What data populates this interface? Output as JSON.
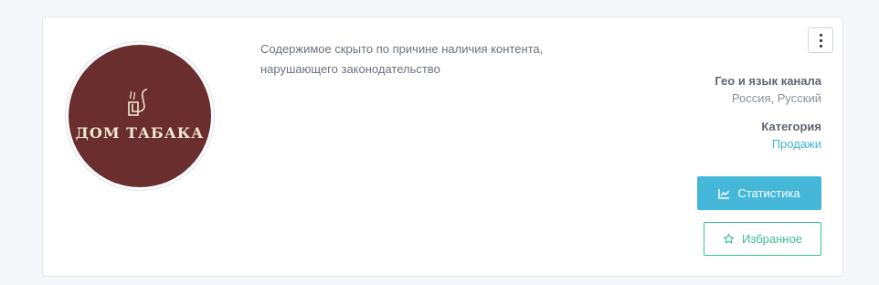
{
  "channel": {
    "avatar_text": "ДОМ ТАБАКА",
    "hidden_notice": "Содержимое скрыто по причине наличия контента, нарушающего законодательство"
  },
  "geo": {
    "label": "Гео и язык канала",
    "value": "Россия, Русский"
  },
  "category": {
    "label": "Категория",
    "value": "Продажи"
  },
  "buttons": {
    "stats_label": "Статистика",
    "favorite_label": "Избранное"
  },
  "icons": {
    "menu": "more-vertical-icon",
    "stats": "chart-line-icon",
    "favorite": "star-outline-icon",
    "logo": "smoking-pipe-icon"
  },
  "colors": {
    "accent": "#45b8da",
    "favorite": "#3bbf8e",
    "avatar_bg": "#6a2e2f"
  }
}
